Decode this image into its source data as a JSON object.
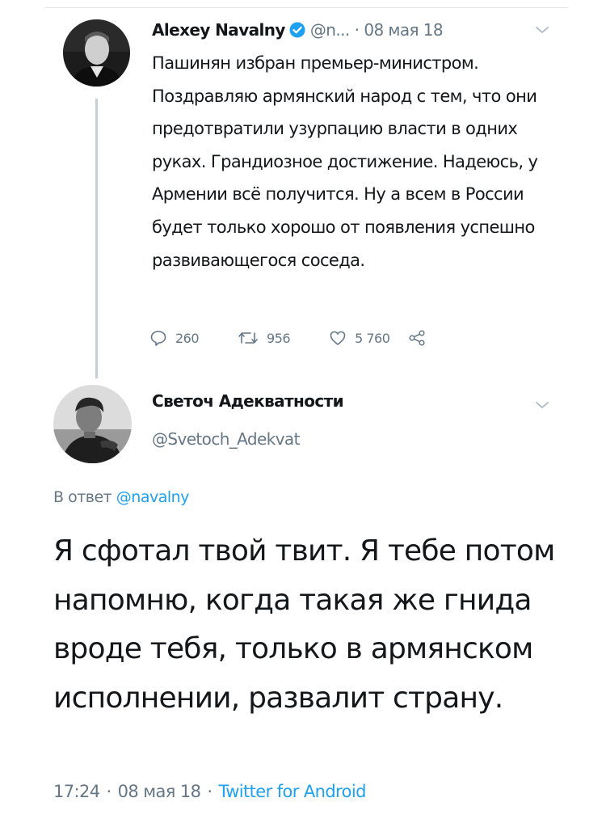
{
  "tweet": {
    "author_name": "Alexey Navalny",
    "handle": "@n...",
    "separator": "·",
    "date": "08 мая 18",
    "text": "Пашинян избран премьер-министром. Поздравляю армянский народ с тем, что они предотвратили узурпацию власти в одних руках. Грандиозное достижение. Надеюсь, у Армении всё получится. Ну а всем в России будет только хорошо от появления успешно развивающегося соседа.",
    "replies": "260",
    "retweets": "956",
    "likes": "5 760"
  },
  "reply": {
    "author_name": "Светоч Адекватности",
    "handle": "@Svetoch_Adekvat",
    "reply_prefix": "В ответ",
    "reply_mention": "@navalny",
    "text": "Я сфотал твой твит. Я тебе потом напомню, когда такая же гнида вроде тебя, только в армянском исполнении, развалит страну.",
    "time": "17:24",
    "separator": "·",
    "date": "08 мая 18",
    "source": "Twitter for Android"
  },
  "colors": {
    "text": "#14171a",
    "secondary": "#657786",
    "link": "#1da1f2",
    "thread_line": "#c4cfd6"
  },
  "icons": [
    "verified-badge-icon",
    "chevron-down-icon",
    "reply-icon",
    "retweet-icon",
    "like-icon",
    "share-icon"
  ]
}
